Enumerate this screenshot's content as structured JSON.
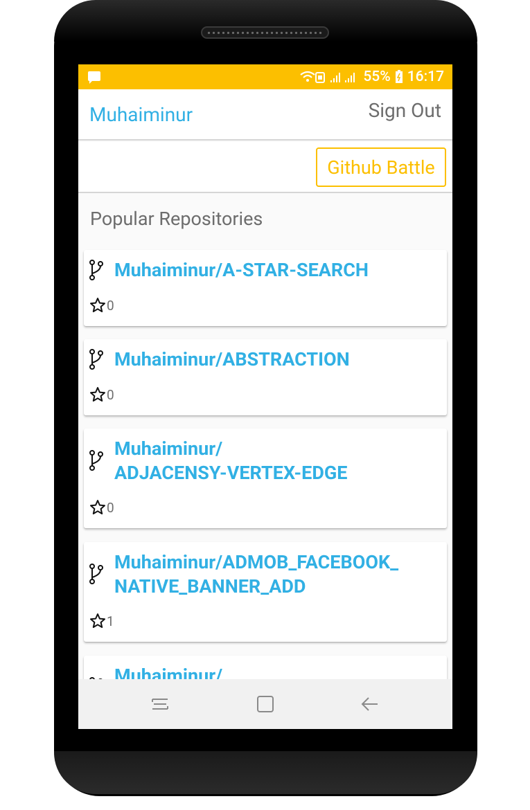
{
  "status_bar": {
    "battery": "55%",
    "time": "16:17"
  },
  "app_bar": {
    "title": "Muhaiminur",
    "sign_out_label": "Sign Out"
  },
  "actions": {
    "battle_label": "Github Battle"
  },
  "section": {
    "title": "Popular Repositories"
  },
  "repositories": [
    {
      "name": "Muhaiminur/A-STAR-SEARCH",
      "stars": "0"
    },
    {
      "name": "Muhaiminur/ABSTRACTION",
      "stars": "0"
    },
    {
      "name_line1": "Muhaiminur/",
      "name_line2": "ADJACENSY-VERTEX-EDGE",
      "stars": "0"
    },
    {
      "name_line1": "Muhaiminur/ADMOB_FACEBOOK_",
      "name_line2": "NATIVE_BANNER_ADD",
      "stars": "1"
    },
    {
      "name_line1": "Muhaiminur/"
    }
  ],
  "colors": {
    "accent": "#31b0e4",
    "brand_yellow": "#fcbf00",
    "muted_text": "#6d6d6d"
  },
  "icons": [
    "message-icon",
    "wifi-icon",
    "signal-icon",
    "battery-icon",
    "branch-icon",
    "star-icon",
    "recents-icon",
    "home-icon",
    "back-icon"
  ]
}
